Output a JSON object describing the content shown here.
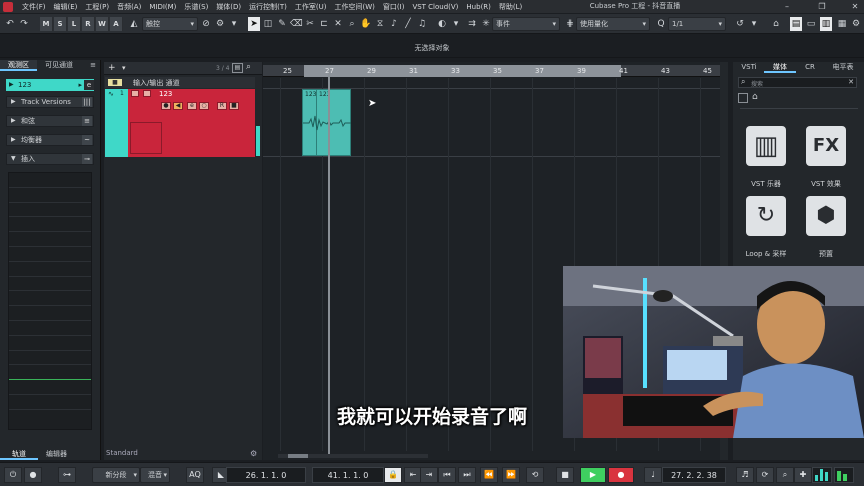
{
  "window_title": "Cubase Pro 工程 - 抖音直播",
  "menu": [
    "文件(F)",
    "编辑(E)",
    "工程(P)",
    "音频(A)",
    "MIDI(M)",
    "乐谱(S)",
    "媒体(D)",
    "运行控制(T)",
    "工作室(U)",
    "工作空间(W)",
    "窗口(I)",
    "VST Cloud(V)",
    "Hub(R)",
    "帮助(L)"
  ],
  "toolbar": {
    "toggles": [
      "M",
      "S",
      "L",
      "R",
      "W",
      "A"
    ],
    "automation_mode": "触控",
    "snap_type": "事件",
    "grid_type": "使用量化",
    "quantize": "1/1"
  },
  "status_text": "无选择对象",
  "inspector": {
    "tabs": [
      "观测区",
      "可见通道"
    ],
    "track_name": "123",
    "sections": [
      "Track Versions",
      "和弦",
      "均衡器",
      "插入"
    ],
    "bottom_tabs": [
      "轨道",
      "编辑器"
    ]
  },
  "tracklist": {
    "track_count": "3 / 4",
    "folder_name": "输入/输出 通道",
    "track_number": "1",
    "track_name": "123",
    "preset": "Standard"
  },
  "ruler": {
    "labels": [
      "25",
      "27",
      "29",
      "31",
      "33",
      "35",
      "37",
      "39",
      "41",
      "43",
      "45"
    ],
    "locator_start": "26",
    "locator_end": "41"
  },
  "events": [
    "123",
    "123"
  ],
  "rightzone": {
    "tabs": [
      "VSTi",
      "媒体",
      "CR",
      "电平表"
    ],
    "search_placeholder": "搜索",
    "tiles": [
      "VST 乐器",
      "VST 效果",
      "Loop & 采样",
      "预置"
    ]
  },
  "subtitle": "我就可以开始录音了啊",
  "transport": {
    "cycle_mode": "新分段",
    "mix_mode": "混音",
    "aq": "AQ",
    "left_locator": "26. 1. 1. 0",
    "right_locator": "41. 1. 1. 0",
    "position": "27. 2. 2. 38"
  },
  "colors": {
    "track_color": "#c9253b",
    "event_color": "#4dbdb3",
    "accent": "#6ec6ff",
    "play": "#3fcf60",
    "record": "#d9343f"
  }
}
